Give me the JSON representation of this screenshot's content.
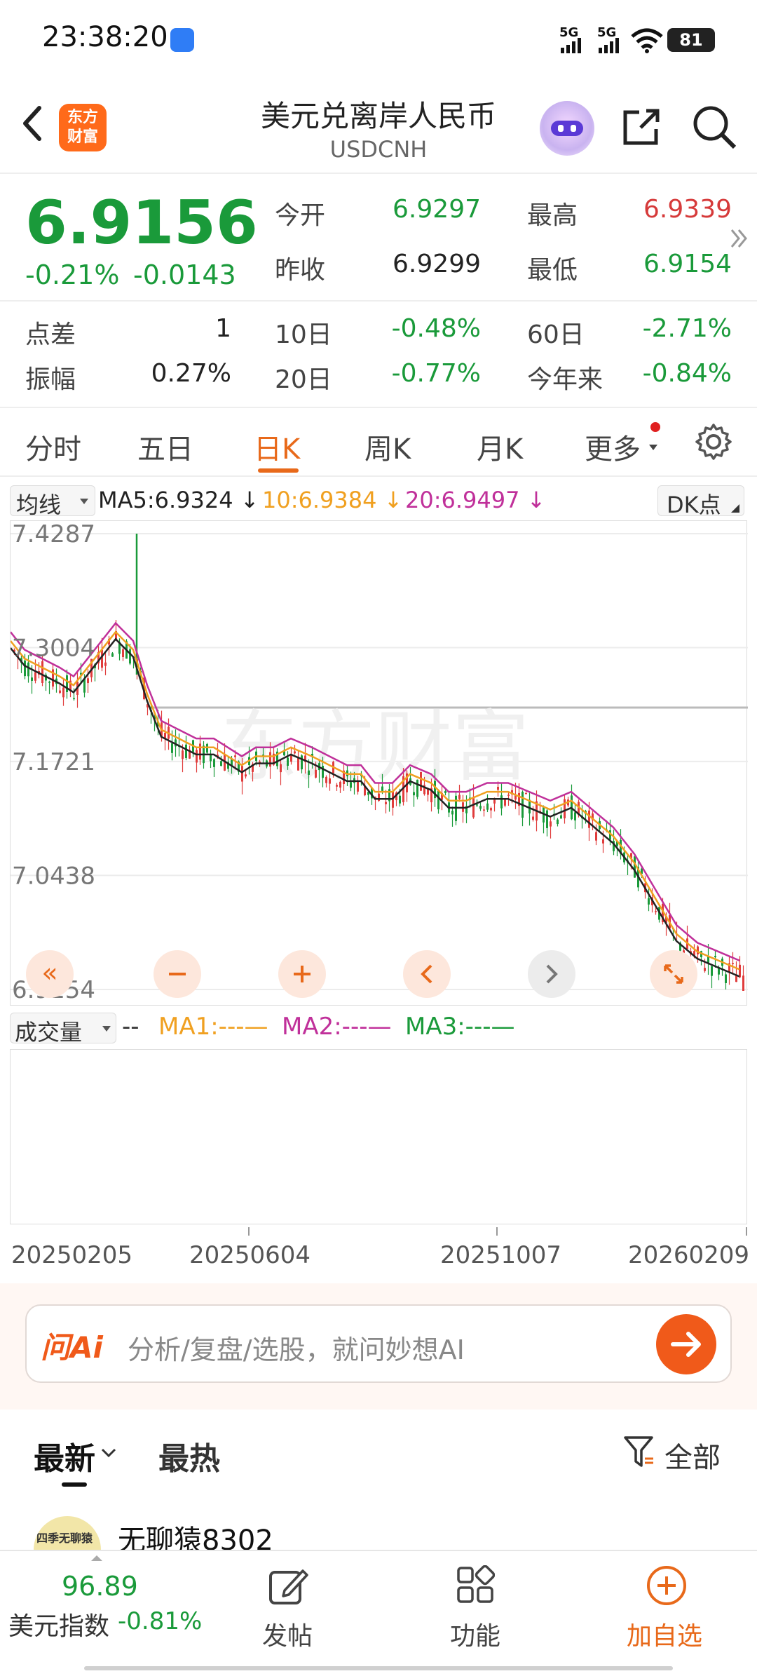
{
  "status": {
    "time": "23:38:20",
    "battery": "81",
    "sig1": "5G",
    "sig2": "5G"
  },
  "nav": {
    "logo": "东方\n财富",
    "title": "美元兑离岸人民币",
    "subtitle": "USDCNH"
  },
  "quote": {
    "price": "6.9156",
    "change_pct": "-0.21%",
    "change": "-0.0143",
    "open_label": "今开",
    "open": "6.9297",
    "high_label": "最高",
    "high": "6.9339",
    "prev_label": "昨收",
    "prev": "6.9299",
    "low_label": "最低",
    "low": "6.9154",
    "spread_label": "点差",
    "spread": "1",
    "d10_label": "10日",
    "d10": "-0.48%",
    "d60_label": "60日",
    "d60": "-2.71%",
    "amp_label": "振幅",
    "amp": "0.27%",
    "d20_label": "20日",
    "d20": "-0.77%",
    "ytd_label": "今年来",
    "ytd": "-0.84%"
  },
  "tabs": [
    "分时",
    "五日",
    "日K",
    "周K",
    "月K",
    "更多"
  ],
  "ma_legend": {
    "dropdown": "均线",
    "ma5": "MA5:6.9324 ↓",
    "ma10": "10:6.9384 ↓",
    "ma20": "20:6.9497 ↓",
    "dk": "DK点"
  },
  "chart_data": {
    "type": "candlestick",
    "y_ticks": [
      "7.4287",
      "7.3004",
      "7.1721",
      "7.0438",
      "6.9154"
    ],
    "ylim": [
      6.9154,
      7.4287
    ],
    "watermark": "东方财富",
    "colors": {
      "up": "#e03c3c",
      "down": "#1a9a3a",
      "ma5": "#222222",
      "ma10": "#f0a020",
      "ma20": "#c0309a"
    }
  },
  "volume_legend": {
    "dropdown": "成交量",
    "dash": "--",
    "ma1": "MA1:---—",
    "ma2": "MA2:---—",
    "ma3": "MA3:---—"
  },
  "dates": [
    "20250205",
    "20250604",
    "20251007",
    "20260209"
  ],
  "ai": {
    "logo": "问Ai",
    "placeholder": "分析/复盘/选股，就问妙想AI"
  },
  "feed": {
    "tab_latest": "最新",
    "tab_hot": "最热",
    "filter": "全部",
    "user": "无聊猿8302",
    "avatar_text": "四季无聊猿"
  },
  "bottom": {
    "index_value": "96.89",
    "index_name": "美元指数",
    "index_change": "-0.81%",
    "post": "发帖",
    "func": "功能",
    "add": "加自选"
  }
}
